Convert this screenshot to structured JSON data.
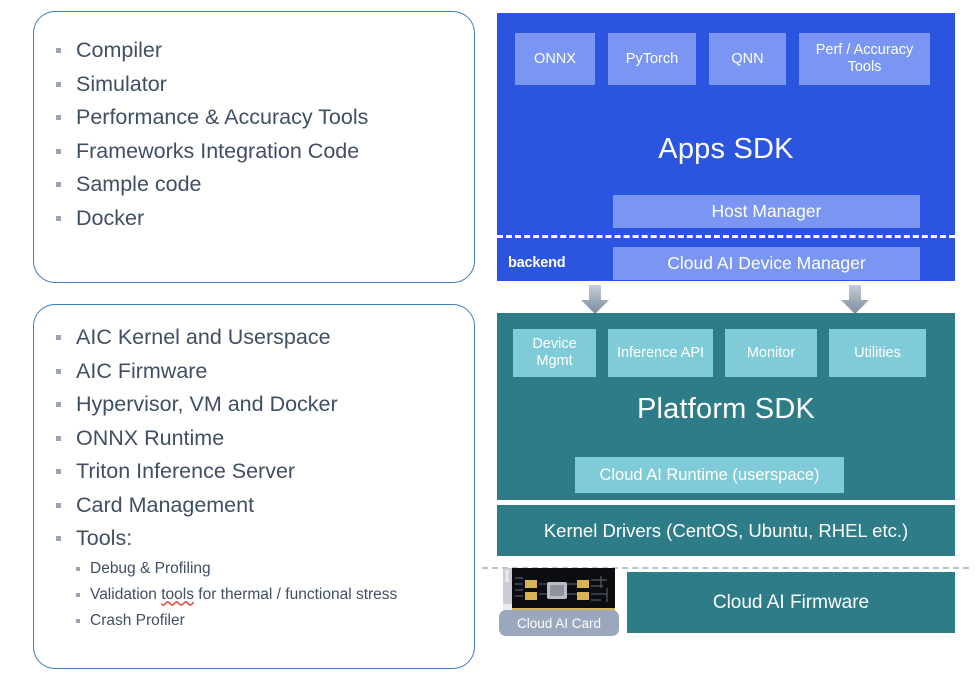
{
  "left_column": {
    "apps_box": {
      "items": [
        "Compiler",
        "Simulator",
        "Performance & Accuracy Tools",
        "Frameworks Integration Code",
        "Sample code",
        "Docker"
      ]
    },
    "platform_box": {
      "items": [
        "AIC Kernel and Userspace",
        "AIC Firmware",
        "Hypervisor, VM and Docker",
        "ONNX Runtime",
        "Triton Inference Server",
        "Card Management",
        "Tools:"
      ],
      "sub_items": [
        "Debug & Profiling",
        {
          "prefix": "Validation ",
          "misspelled": "tools",
          "suffix": " for thermal / functional stress"
        },
        "Crash Profiler"
      ]
    }
  },
  "apps_sdk": {
    "title": "Apps SDK",
    "chips": [
      "ONNX",
      "PyTorch",
      "QNN",
      "Perf / Accuracy Tools"
    ],
    "host_manager": "Host Manager",
    "device_manager": "Cloud AI Device Manager",
    "backend_label": "backend",
    "color": "#2B55DE",
    "chip_color": "#7B96F2"
  },
  "platform_sdk": {
    "title": "Platform SDK",
    "chips": [
      "Device Mgmt",
      "Inference API",
      "Monitor",
      "Utilities"
    ],
    "runtime": "Cloud AI Runtime (userspace)",
    "color": "#2D7C88",
    "chip_color": "#7FCBD8"
  },
  "kernel_drivers": {
    "label": "Kernel Drivers (CentOS, Ubuntu, RHEL etc.)"
  },
  "firmware": {
    "label": "Cloud AI Firmware"
  },
  "card": {
    "label": "Cloud AI Card"
  },
  "colors": {
    "box_border": "#3A7CB8",
    "text": "#3F4F64",
    "bullet": "#9AA4B2",
    "arrow": "#8C9AA8",
    "card_label_bg": "#9AA7BC"
  }
}
